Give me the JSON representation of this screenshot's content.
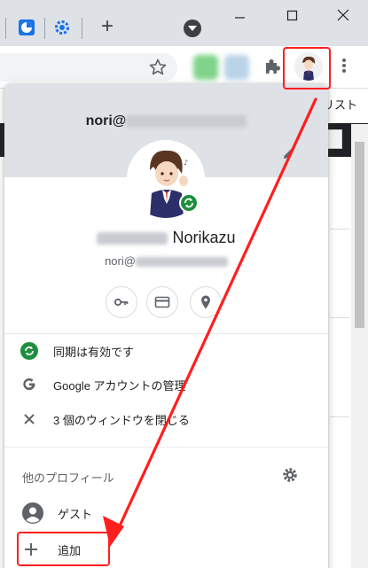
{
  "tabs": {
    "new_tab_symbol": "+"
  },
  "toolbar": {
    "star_icon": "star-icon",
    "extensions_icon": "puzzle-icon",
    "menu_icon": "kebab-icon"
  },
  "page": {
    "right_text": "リスト"
  },
  "popup": {
    "email_prefix": "nori@",
    "name_suffix": "Norikazu",
    "email_line_prefix": "nori@",
    "quick_actions": [
      {
        "name": "passwords",
        "icon": "key-icon"
      },
      {
        "name": "payment-methods",
        "icon": "credit-card-icon"
      },
      {
        "name": "addresses",
        "icon": "location-pin-icon"
      }
    ],
    "menu": [
      {
        "label": "同期は有効です",
        "icon": "sync-icon"
      },
      {
        "label": "Google アカウントの管理",
        "icon": "google-g-icon"
      },
      {
        "label": "3 個のウィンドウを閉じる",
        "icon": "close-icon"
      }
    ],
    "other_profiles_title": "他のプロフィール",
    "profiles": [
      {
        "label": "ゲスト",
        "icon": "guest-avatar-icon"
      }
    ],
    "add_label": "追加"
  },
  "colors": {
    "highlight": "#ff1e1e",
    "sync_green": "#1e8e3e",
    "header_gray": "#dee1e6"
  }
}
